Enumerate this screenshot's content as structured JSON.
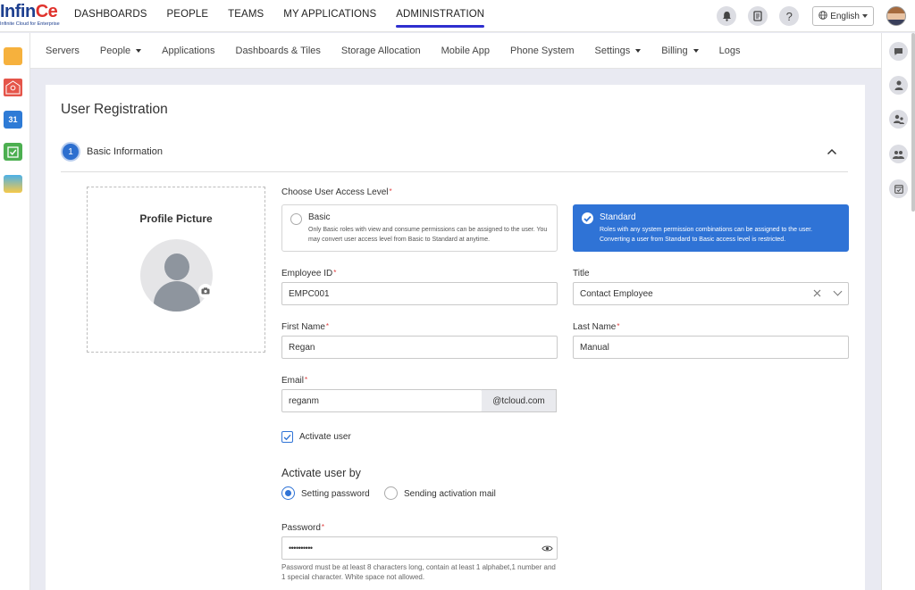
{
  "brand": {
    "name_part1": "Infin",
    "name_part2": "Ce",
    "tagline": "Infinite Cloud for Enterprise"
  },
  "topnav": [
    "DASHBOARDS",
    "PEOPLE",
    "TEAMS",
    "MY APPLICATIONS",
    "ADMINISTRATION"
  ],
  "topnav_active": "ADMINISTRATION",
  "header": {
    "language": "English",
    "help_glyph": "?"
  },
  "subnav": [
    {
      "label": "Servers",
      "dropdown": false
    },
    {
      "label": "People",
      "dropdown": true
    },
    {
      "label": "Applications",
      "dropdown": false
    },
    {
      "label": "Dashboards & Tiles",
      "dropdown": false
    },
    {
      "label": "Storage Allocation",
      "dropdown": false
    },
    {
      "label": "Mobile App",
      "dropdown": false
    },
    {
      "label": "Phone System",
      "dropdown": false
    },
    {
      "label": "Settings",
      "dropdown": true
    },
    {
      "label": "Billing",
      "dropdown": true
    },
    {
      "label": "Logs",
      "dropdown": false
    }
  ],
  "left_dock": {
    "icons": [
      "folder-icon",
      "mail-icon",
      "calendar-icon",
      "tasks-icon",
      "photos-icon"
    ],
    "calendar_day": "31"
  },
  "right_dock": [
    "chat-icon",
    "user-icon",
    "user-group-icon",
    "team-icon",
    "calendar-check-icon"
  ],
  "page": {
    "title": "User Registration",
    "section": {
      "number": "1",
      "title": "Basic Information"
    },
    "profile_picture_label": "Profile Picture",
    "access_level": {
      "label": "Choose User Access Level",
      "basic": {
        "title": "Basic",
        "desc": "Only Basic roles with view and consume permissions can be assigned to the user. You may convert user access level from Basic to Standard at anytime."
      },
      "standard": {
        "title": "Standard",
        "desc": "Roles with any system permission combinations can be assigned to the user. Converting a user from Standard to Basic access level is restricted."
      },
      "selected": "Standard"
    },
    "fields": {
      "employee_id": {
        "label": "Employee ID",
        "value": "EMPC001"
      },
      "title": {
        "label": "Title",
        "value": "Contact Employee"
      },
      "first_name": {
        "label": "First Name",
        "value": "Regan"
      },
      "last_name": {
        "label": "Last Name",
        "value": "Manual"
      },
      "email": {
        "label": "Email",
        "value": "reganm",
        "domain": "@tcloud.com"
      },
      "password": {
        "label": "Password",
        "value": "••••••••••"
      }
    },
    "activate_user": {
      "label": "Activate user",
      "checked": true
    },
    "activate_by": {
      "heading": "Activate user by",
      "options": [
        "Setting password",
        "Sending activation mail"
      ],
      "selected": "Setting password"
    },
    "password_hint": "Password must be at least 8 characters long, contain at least 1 alphabet,1 number and 1 special character. White space not allowed.",
    "required_mark": "*"
  },
  "colors": {
    "primary": "#2f73d6",
    "nav_underline": "#2f2fcf",
    "brand_blue": "#1d3f8f",
    "brand_red": "#e0322c"
  }
}
